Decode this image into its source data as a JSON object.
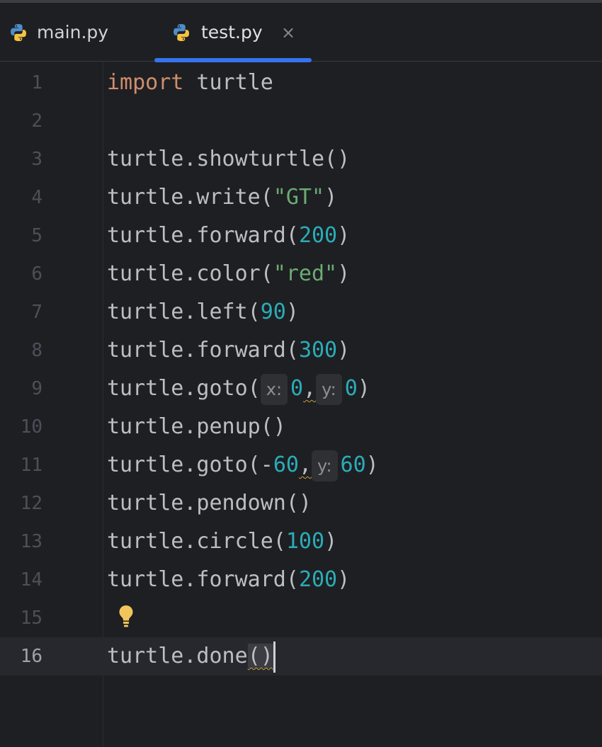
{
  "tabs": [
    {
      "label": "main.py",
      "icon": "python-icon",
      "active": false
    },
    {
      "label": "test.py",
      "icon": "python-icon",
      "active": true,
      "close_icon": "×"
    }
  ],
  "editor": {
    "lines": [
      {
        "num": "1",
        "kw": "import",
        "rest": " turtle"
      },
      {
        "num": "2"
      },
      {
        "num": "3",
        "text": "turtle.showturtle()"
      },
      {
        "num": "4",
        "pre": "turtle.write(",
        "str": "\"GT\"",
        "post": ")"
      },
      {
        "num": "5",
        "pre": "turtle.forward(",
        "n": "200",
        "post": ")"
      },
      {
        "num": "6",
        "pre": "turtle.color(",
        "str": "\"red\"",
        "post": ")"
      },
      {
        "num": "7",
        "pre": "turtle.left(",
        "n": "90",
        "post": ")"
      },
      {
        "num": "8",
        "pre": "turtle.forward(",
        "n": "300",
        "post": ")"
      },
      {
        "num": "9",
        "pre": "turtle.goto(",
        "hint_x": "x:",
        "n1": "0",
        "comma": ",",
        "hint_y": "y:",
        "n2": "0",
        "post": ")"
      },
      {
        "num": "10",
        "text": "turtle.penup()"
      },
      {
        "num": "11",
        "pre": "turtle.goto(-",
        "n1": "60",
        "comma": ",",
        "hint_y": "y:",
        "n2": "60",
        "post": ")"
      },
      {
        "num": "12",
        "text": "turtle.pendown()"
      },
      {
        "num": "13",
        "pre": "turtle.circle(",
        "n": "100",
        "post": ")"
      },
      {
        "num": "14",
        "pre": "turtle.forward(",
        "n": "200",
        "post": ")"
      },
      {
        "num": "15",
        "icon": "lightbulb-icon"
      },
      {
        "num": "16",
        "pre": "turtle.done",
        "paren": "()",
        "current": true
      }
    ]
  },
  "colors": {
    "background": "#1e1f22",
    "keyword": "#cf8e6d",
    "string": "#6aab73",
    "number": "#2aacb8",
    "text": "#bcbec4",
    "tab_underline": "#3574f0",
    "bulb": "#f2c55c"
  }
}
